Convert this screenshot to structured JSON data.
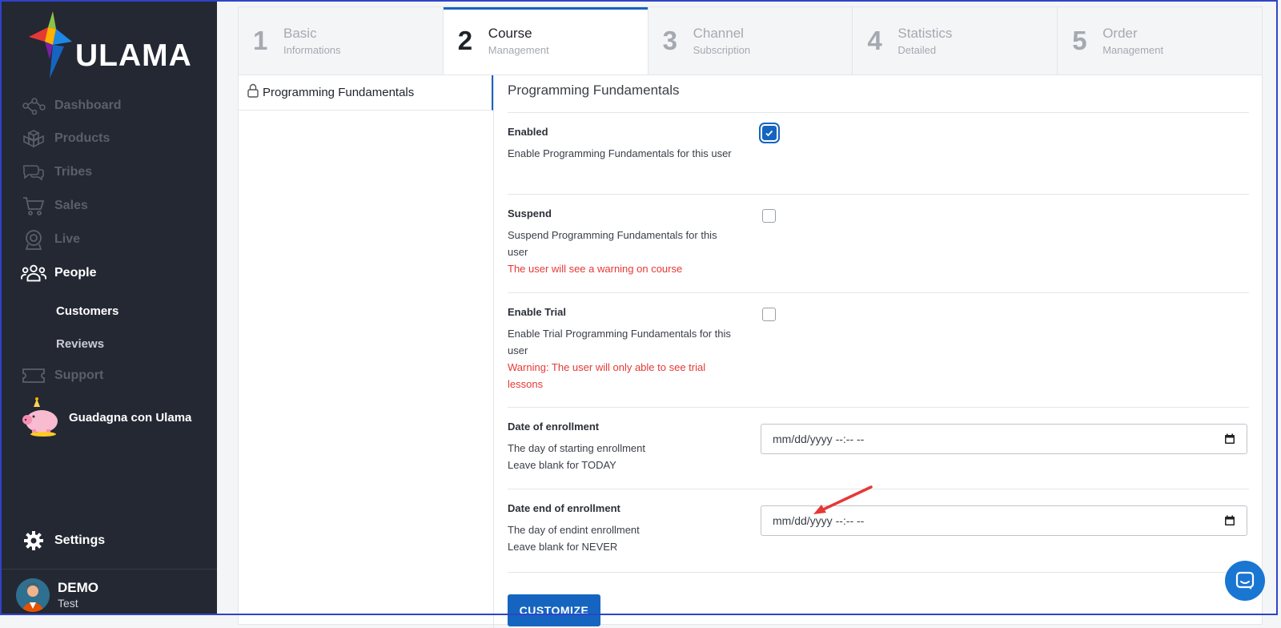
{
  "brand": {
    "name": "ULAMA"
  },
  "sidebar": {
    "items": [
      {
        "label": "Dashboard",
        "icon": "nodes-icon"
      },
      {
        "label": "Products",
        "icon": "boxes-icon"
      },
      {
        "label": "Tribes",
        "icon": "chat-bubbles-icon"
      },
      {
        "label": "Sales",
        "icon": "cart-icon"
      },
      {
        "label": "Live",
        "icon": "webcam-icon"
      },
      {
        "label": "People",
        "icon": "people-icon"
      }
    ],
    "subitems": [
      {
        "label": "Customers"
      },
      {
        "label": "Reviews"
      }
    ],
    "support": {
      "label": "Support",
      "icon": "ticket-icon"
    },
    "promo": {
      "label": "Guadagna con Ulama",
      "icon": "piggy-bank-icon"
    },
    "settings": {
      "label": "Settings",
      "icon": "gear-icon"
    },
    "user": {
      "name": "DEMO",
      "sub": "Test"
    }
  },
  "steps": [
    {
      "num": "1",
      "title": "Basic",
      "sub": "Informations"
    },
    {
      "num": "2",
      "title": "Course",
      "sub": "Management"
    },
    {
      "num": "3",
      "title": "Channel",
      "sub": "Subscription"
    },
    {
      "num": "4",
      "title": "Statistics",
      "sub": "Detailed"
    },
    {
      "num": "5",
      "title": "Order",
      "sub": "Management"
    }
  ],
  "course_list": {
    "item": "Programming Fundamentals"
  },
  "form": {
    "title": "Programming Fundamentals",
    "enabled": {
      "label": "Enabled",
      "desc": "Enable Programming Fundamentals for this user",
      "checked": true
    },
    "suspend": {
      "label": "Suspend",
      "desc": "Suspend Programming Fundamentals for this user",
      "warning": "The user will see a warning on course",
      "checked": false
    },
    "trial": {
      "label": "Enable Trial",
      "desc": "Enable Trial Programming Fundamentals for this user",
      "warning": "Warning: The user will only able to see trial lessons",
      "checked": false
    },
    "date_start": {
      "label": "Date of enrollment",
      "desc1": "The day of starting enrollment",
      "desc2": "Leave blank for TODAY",
      "placeholder": "mm/dd/yyyy --:-- --"
    },
    "date_end": {
      "label": "Date end of enrollment",
      "desc1": "The day of endint enrollment",
      "desc2": "Leave blank for NEVER",
      "placeholder": "mm/dd/yyyy --:-- --"
    },
    "customize": "CUSTOMIZE"
  },
  "colors": {
    "accent": "#1565c0",
    "sidebar_bg": "#242833",
    "warning": "#e53935",
    "annotation_arrow": "#e53935"
  }
}
